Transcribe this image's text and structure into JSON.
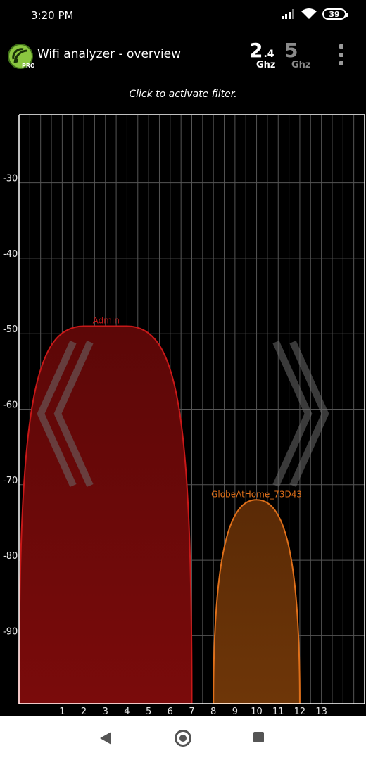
{
  "status_bar": {
    "time": "3:20 PM",
    "battery": "39"
  },
  "app_bar": {
    "title": "Wifi analyzer - overview",
    "logo_badge": "PRO",
    "band_24": {
      "major": "2",
      "minor": ".4",
      "unit": "Ghz"
    },
    "band_5": {
      "major": "5",
      "unit": "Ghz"
    }
  },
  "filter_hint": "Click to activate filter.",
  "colors": {
    "admin": "#c81818",
    "globe": "#e0701a",
    "grid": "#555555",
    "axis": "#ffffff"
  },
  "chart_data": {
    "type": "area",
    "title": "",
    "xlabel": "",
    "ylabel": "",
    "x_ticks": [
      "1",
      "2",
      "3",
      "4",
      "5",
      "6",
      "7",
      "8",
      "9",
      "10",
      "11",
      "12",
      "13"
    ],
    "y_ticks": [
      "-30",
      "-40",
      "-50",
      "-60",
      "-70",
      "-80",
      "-90"
    ],
    "xlim": [
      -1,
      15
    ],
    "ylim": [
      -99,
      -21
    ],
    "grid": true,
    "series": [
      {
        "name": "Admin",
        "center": 3,
        "width": 4,
        "level": -49,
        "shape": "flat",
        "color": "#c81818"
      },
      {
        "name": "GlobeAtHome_73D43",
        "center": 10,
        "width": 2,
        "level": -72,
        "shape": "peak",
        "color": "#e0701a"
      }
    ]
  },
  "nav_bar": {
    "back": "back",
    "home": "home",
    "recent": "recent-apps"
  }
}
